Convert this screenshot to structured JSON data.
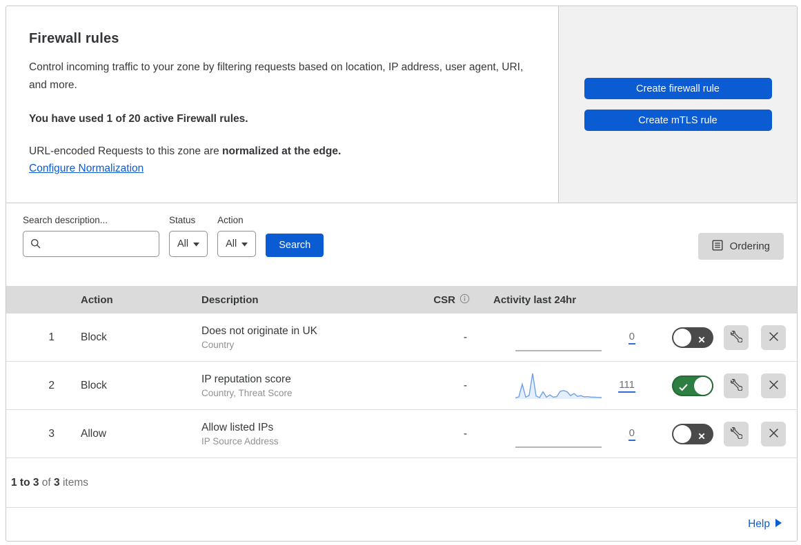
{
  "header": {
    "title": "Firewall rules",
    "description": "Control incoming traffic to your zone by filtering requests based on location, IP address, user agent, URI, and more.",
    "usage_notice": "You have used 1 of 20 active Firewall rules.",
    "normalization_prefix": "URL-encoded Requests to this zone are ",
    "normalization_bold": "normalized at the edge.",
    "normalization_link": "Configure Normalization",
    "buttons": {
      "create_firewall_rule": "Create firewall rule",
      "create_mtls_rule": "Create mTLS rule"
    }
  },
  "filters": {
    "search_label": "Search description...",
    "search_value": "",
    "status_label": "Status",
    "status_value": "All",
    "action_label": "Action",
    "action_value": "All",
    "search_button": "Search",
    "ordering_button": "Ordering"
  },
  "table": {
    "columns": {
      "action": "Action",
      "description": "Description",
      "csr": "CSR",
      "activity": "Activity last 24hr"
    },
    "rows": [
      {
        "num": "1",
        "action": "Block",
        "description": "Does not originate in UK",
        "criteria": "Country",
        "csr": "-",
        "count": "0",
        "enabled": false,
        "sparkline": null
      },
      {
        "num": "2",
        "action": "Block",
        "description": "IP reputation score",
        "criteria": "Country, Threat Score",
        "csr": "-",
        "count": "111",
        "enabled": true,
        "sparkline": [
          4,
          8,
          58,
          7,
          14,
          100,
          12,
          5,
          28,
          7,
          16,
          7,
          9,
          30,
          33,
          28,
          13,
          21,
          10,
          13,
          8,
          9,
          7,
          7,
          6,
          6
        ]
      },
      {
        "num": "3",
        "action": "Allow",
        "description": "Allow listed IPs",
        "criteria": "IP Source Address",
        "csr": "-",
        "count": "0",
        "enabled": false,
        "sparkline": null
      }
    ]
  },
  "chart_data": {
    "type": "area",
    "title": "Activity last 24hr sparkline (rule 2)",
    "x": "time over last 24hr (unlabeled)",
    "values": [
      4,
      8,
      58,
      7,
      14,
      100,
      12,
      5,
      28,
      7,
      16,
      7,
      9,
      30,
      33,
      28,
      13,
      21,
      10,
      13,
      8,
      9,
      7,
      7,
      6,
      6
    ],
    "total_events": 111,
    "ylabel": "",
    "xlabel": "",
    "grid": false,
    "legend": false
  },
  "footer": {
    "range": "1 to 3",
    "of": " of ",
    "total": "3",
    "items": " items",
    "help": "Help"
  },
  "icons": {
    "search": "magnifier",
    "dropdown": "caret-down",
    "ordering": "ordered-list-document",
    "csr_info": "info-circle",
    "toggle_off": "x-mark",
    "toggle_on": "check-mark",
    "edit": "wrench",
    "delete": "x-mark",
    "help": "caret-right"
  },
  "colors": {
    "accent_blue": "#0b5bd3",
    "link_underline": "#2f6bd0",
    "toggle_on_green": "#2d7e41",
    "toggle_off_gray": "#4a4a4a",
    "sparkline_blue": "#6d9fe8",
    "panel_gray": "#f1f1f1",
    "header_band_gray": "#dbdbdb"
  }
}
